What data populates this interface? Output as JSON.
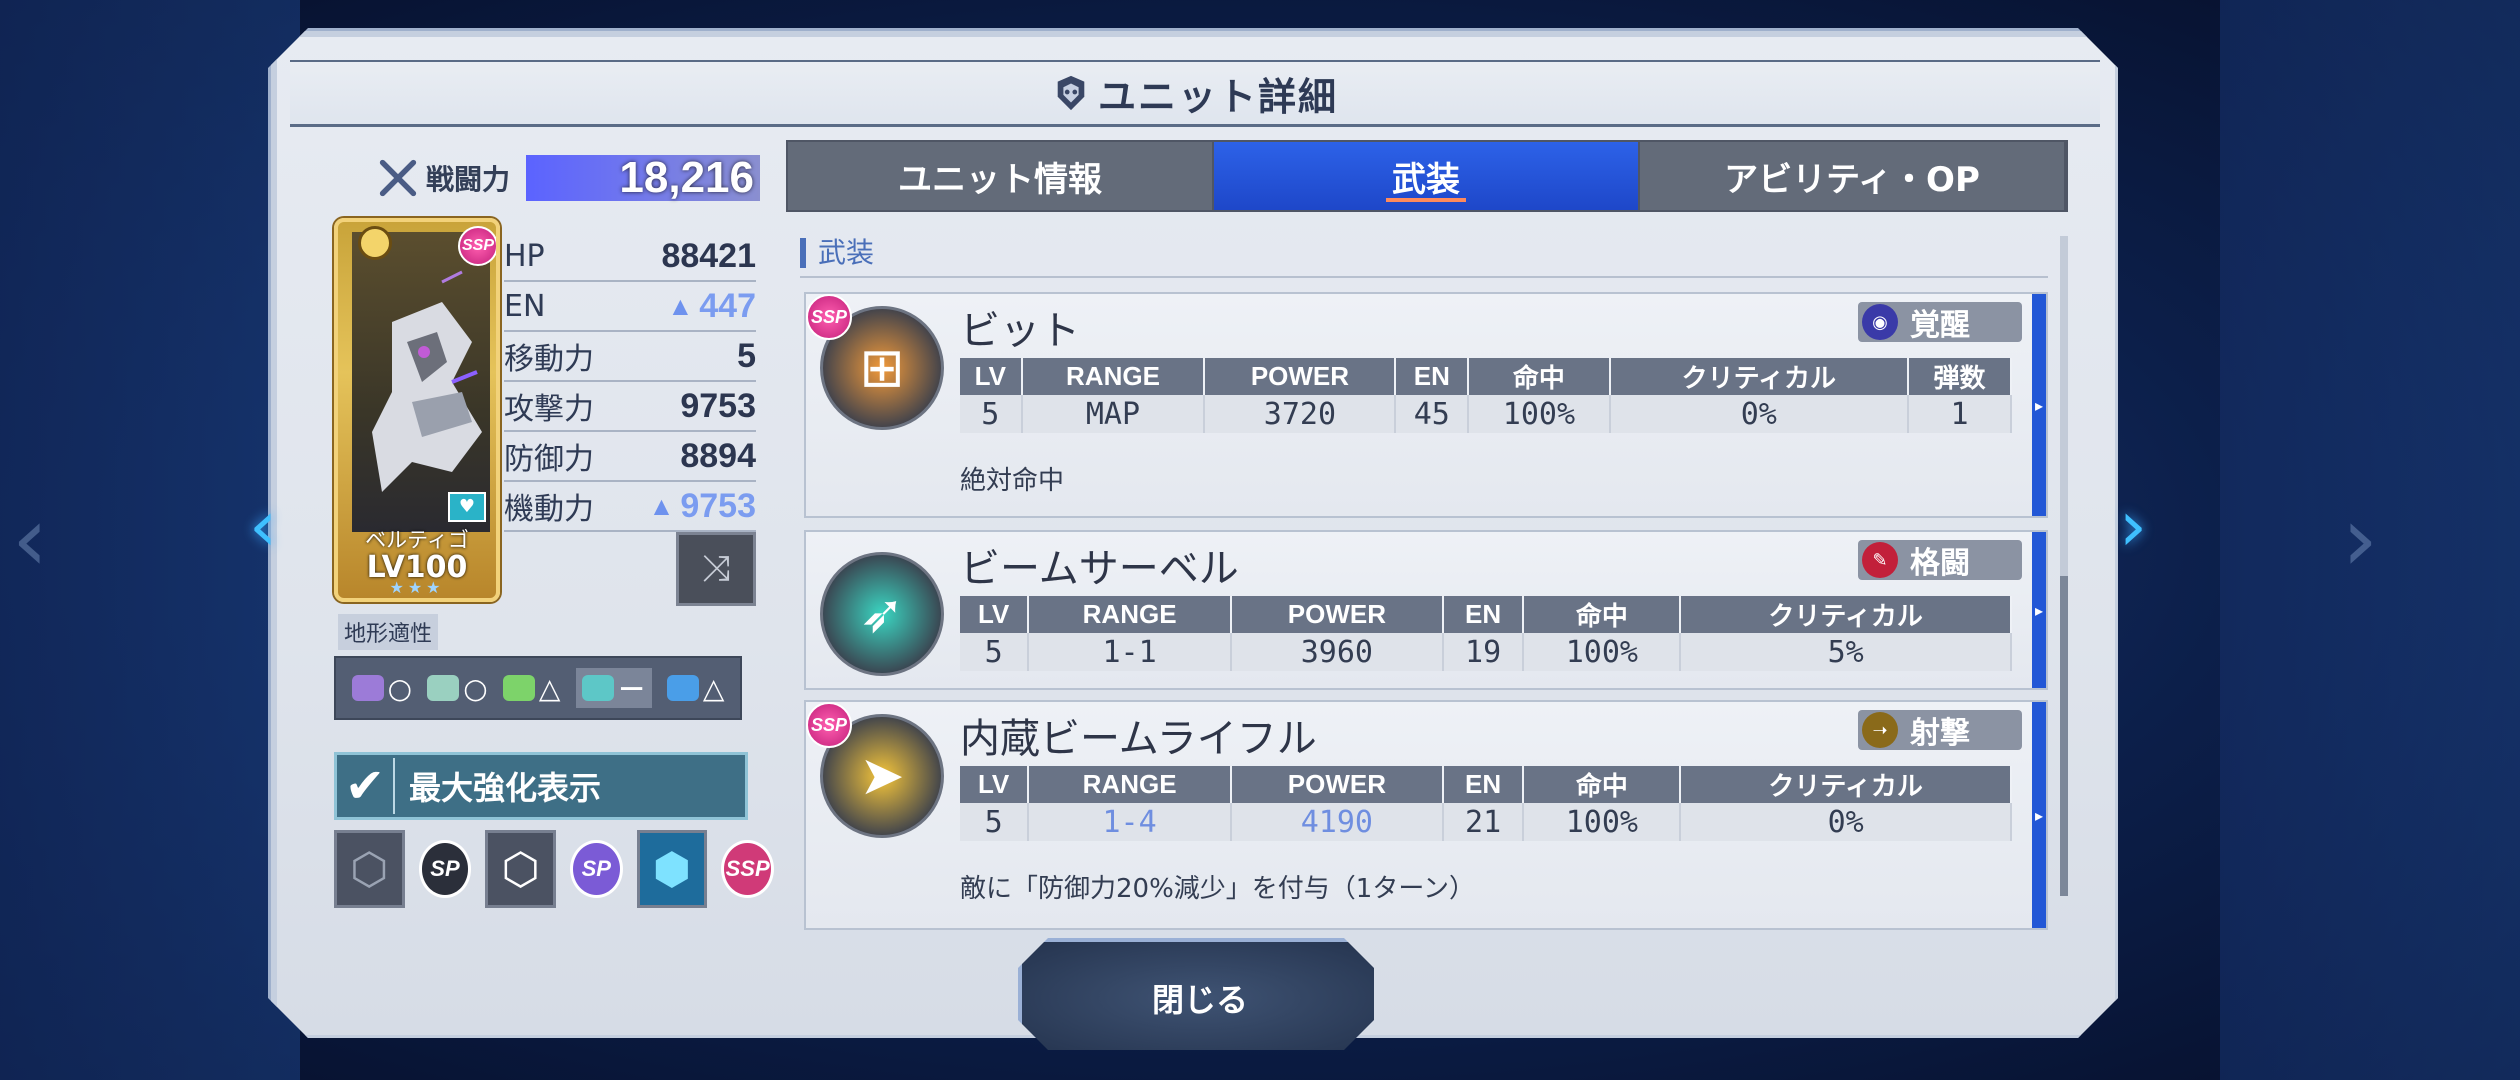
{
  "header": {
    "title": "ユニット詳細"
  },
  "power": {
    "label": "戦闘力",
    "value": "18,216"
  },
  "unit": {
    "name": "ベルティゴ",
    "level": "LV100",
    "stars": "★★★",
    "badge": "SSP"
  },
  "stats": [
    {
      "label": "HP",
      "value": "88421",
      "boosted": false
    },
    {
      "label": "EN",
      "value": "447",
      "boosted": true
    },
    {
      "label": "移動力",
      "value": "5",
      "boosted": false
    },
    {
      "label": "攻撃力",
      "value": "9753",
      "boosted": false
    },
    {
      "label": "防御力",
      "value": "8894",
      "boosted": false
    },
    {
      "label": "機動力",
      "value": "9753",
      "boosted": true
    }
  ],
  "terrain": {
    "label": "地形適性",
    "items": [
      {
        "icon": "space-icon",
        "grade": "○",
        "color": "#9c7bd8"
      },
      {
        "icon": "air-icon",
        "grade": "○",
        "color": "#9ad0c0"
      },
      {
        "icon": "ground-icon",
        "grade": "△",
        "color": "#7dd36a"
      },
      {
        "icon": "water-icon",
        "grade": "－",
        "color": "#5dc7c7"
      },
      {
        "icon": "underwater-icon",
        "grade": "△",
        "color": "#4a9ee8"
      }
    ]
  },
  "max_toggle": {
    "label": "最大強化表示",
    "checked": true
  },
  "option_badges": [
    "SP",
    "SP",
    "SSP"
  ],
  "tabs": [
    {
      "label": "ユニット情報",
      "active": false
    },
    {
      "label": "武装",
      "active": true
    },
    {
      "label": "アビリティ・OP",
      "active": false
    }
  ],
  "section": {
    "label": "武装"
  },
  "weapons": [
    {
      "name": "ビット",
      "type": "覚醒",
      "type_color": "#3a3aa8",
      "icon_color": "#f29a3a",
      "headers": [
        "LV",
        "RANGE",
        "POWER",
        "EN",
        "命中",
        "クリティカル",
        "弾数"
      ],
      "values": [
        "5",
        "MAP",
        "3720",
        "45",
        "100%",
        "0%",
        "1"
      ],
      "desc": "絶対命中"
    },
    {
      "name": "ビームサーベル",
      "type": "格闘",
      "type_color": "#c2203a",
      "icon_color": "#3ad6c2",
      "headers": [
        "LV",
        "RANGE",
        "POWER",
        "EN",
        "命中",
        "クリティカル"
      ],
      "values": [
        "5",
        "1-1",
        "3960",
        "19",
        "100%",
        "5%"
      ],
      "desc": ""
    },
    {
      "name": "内蔵ビームライフル",
      "type": "射撃",
      "type_color": "#8a6a1a",
      "icon_color": "#f5c53a",
      "headers": [
        "LV",
        "RANGE",
        "POWER",
        "EN",
        "命中",
        "クリティカル"
      ],
      "values": [
        "5",
        "1-4",
        "4190",
        "21",
        "100%",
        "0%"
      ],
      "desc": "敵に「防御力20%減少」を付与（1ターン）"
    }
  ],
  "close_button": {
    "label": "閉じる"
  }
}
